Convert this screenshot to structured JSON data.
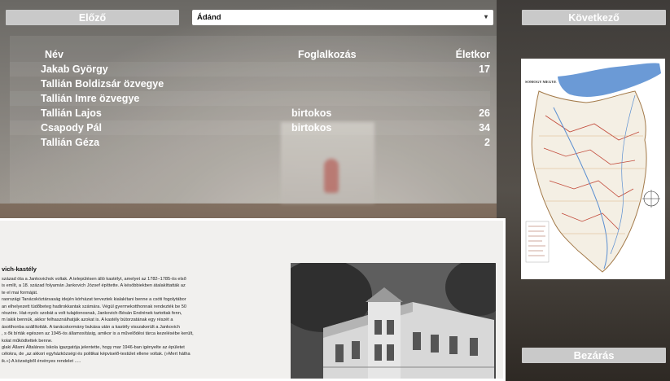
{
  "nav": {
    "prev_label": "Előző",
    "next_label": "Következő",
    "close_label": "Bezárás"
  },
  "selector": {
    "value": "Ádánd"
  },
  "table": {
    "headers": {
      "name": "Név",
      "occupation": "Foglalkozás",
      "age": "Életkor"
    },
    "rows": [
      {
        "name": "Jakab György",
        "occupation": "",
        "age": "17"
      },
      {
        "name": "Tallián Boldizsár özvegye",
        "occupation": "",
        "age": ""
      },
      {
        "name": "Tallián Imre özvegye",
        "occupation": "",
        "age": ""
      },
      {
        "name": "Tallián Lajos",
        "occupation": "birtokos",
        "age": "26"
      },
      {
        "name": "Csapody Pál",
        "occupation": "birtokos",
        "age": "34"
      },
      {
        "name": "Tallián Géza",
        "occupation": "",
        "age": "2"
      }
    ]
  },
  "map": {
    "title": "SOMOGY MEGYE"
  },
  "document": {
    "title": "vich-kastély",
    "lines": [
      "század óta a Jankovichok voltak. A településen álló kastélyt, amelyet az 1782–1785-ös első",
      "is említ, a 18. század folyamán Jankovich József építtette. A késöbbiekben átalakíttatták az",
      "te el mai formáját.",
      "raországi Tanácsköztársaság idején kórházat terveztek kialakítani benne a csóti fogolytábor",
      "an elhelyezett tüdőbeteg hadirokkantak számára. Végül gyermekotthonnak rendezték be 50",
      "részére. Hat-nyolc szobát a volt tulajdonosnak, Jankovich-Bésán Endrének tartottak fenn,",
      "m lakik bennük, akkor felhasználhatják azokat is. A kastély bútorzatának egy részét a",
      "ásotthonba szállították. A tanácskormány bukása után a kastély visszakerült a Jankovich",
      ", s ők bírták egészen az 1945-ös államosításig, amikor is a művelődési tárca kezelésébe került,",
      "kolat működtettek benne.",
      "glaki Állami Általános Iskola igazgatója jelentette, hogy mar 1946-ban igényelte az épületet",
      "célokra, de „az akkori egyházközségi és politikai képviselő-testület ellene voltak. (»Mert hátha",
      "ik.«) A községből érvényes rendelet ....."
    ]
  }
}
